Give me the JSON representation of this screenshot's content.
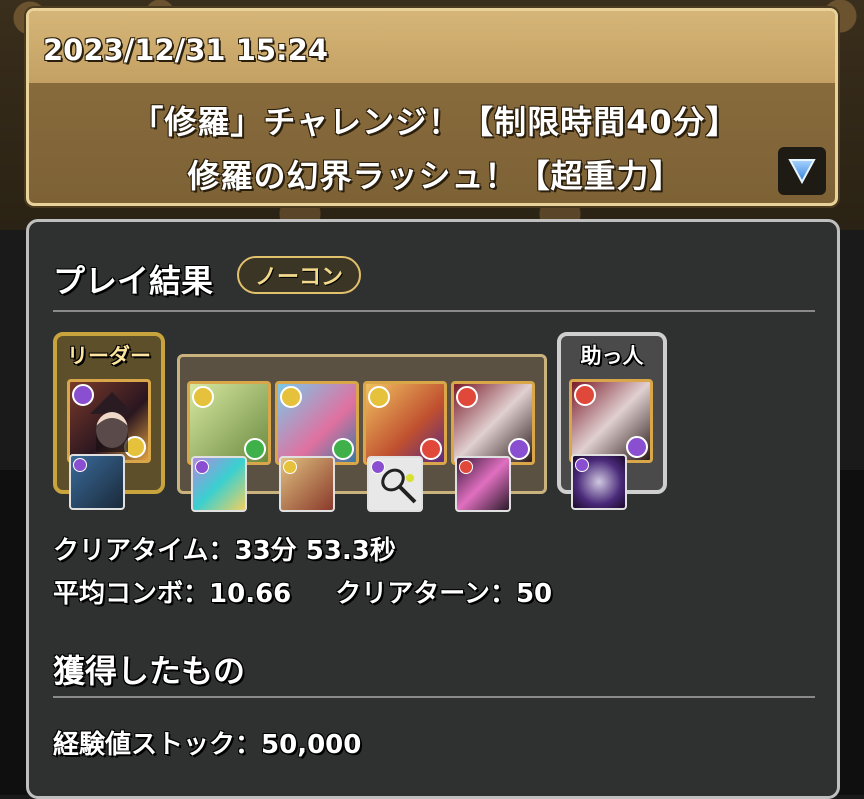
{
  "header": {
    "datetime": "2023/12/31 15:24",
    "title_line1": "「修羅」チャレンジ！【制限時間40分】",
    "title_line2": "修羅の幻界ラッシュ！【超重力】",
    "expand_icon": "triangle-down-icon"
  },
  "results": {
    "heading": "プレイ結果",
    "badge": "ノーコン",
    "leader_label": "リーダー",
    "helper_label": "助っ人",
    "clear_time_label": "クリアタイム：",
    "clear_time_value": "33分 53.3秒",
    "avg_combo_label": "平均コンボ：",
    "avg_combo_value": "10.66",
    "clear_turn_label": "クリアターン：",
    "clear_turn_value": "50"
  },
  "team": {
    "leader": {
      "icon": "witch-character-card",
      "assist": "dark-suit-character-assist"
    },
    "subs": [
      {
        "icon": "green-haired-character-card",
        "assist": "rainbow-dragon-assist"
      },
      {
        "icon": "chopper-character-card",
        "assist": "warrior-character-assist"
      },
      {
        "icon": "horned-demon-character-card",
        "assist": "tennis-racket-assist"
      },
      {
        "icon": "masked-demon-character-card",
        "assist": "pink-swirl-assist"
      }
    ],
    "helper": {
      "icon": "masked-demon-character-card",
      "assist": "dark-orb-assist"
    }
  },
  "rewards": {
    "heading": "獲得したもの",
    "exp_stock_label": "経験値ストック：",
    "exp_stock_value": "50,000"
  },
  "colors": {
    "header_gold": "#c3a063",
    "panel_bg": "#2f3030",
    "leader_border": "#c9a43c",
    "badge_text": "#f3d98b"
  }
}
